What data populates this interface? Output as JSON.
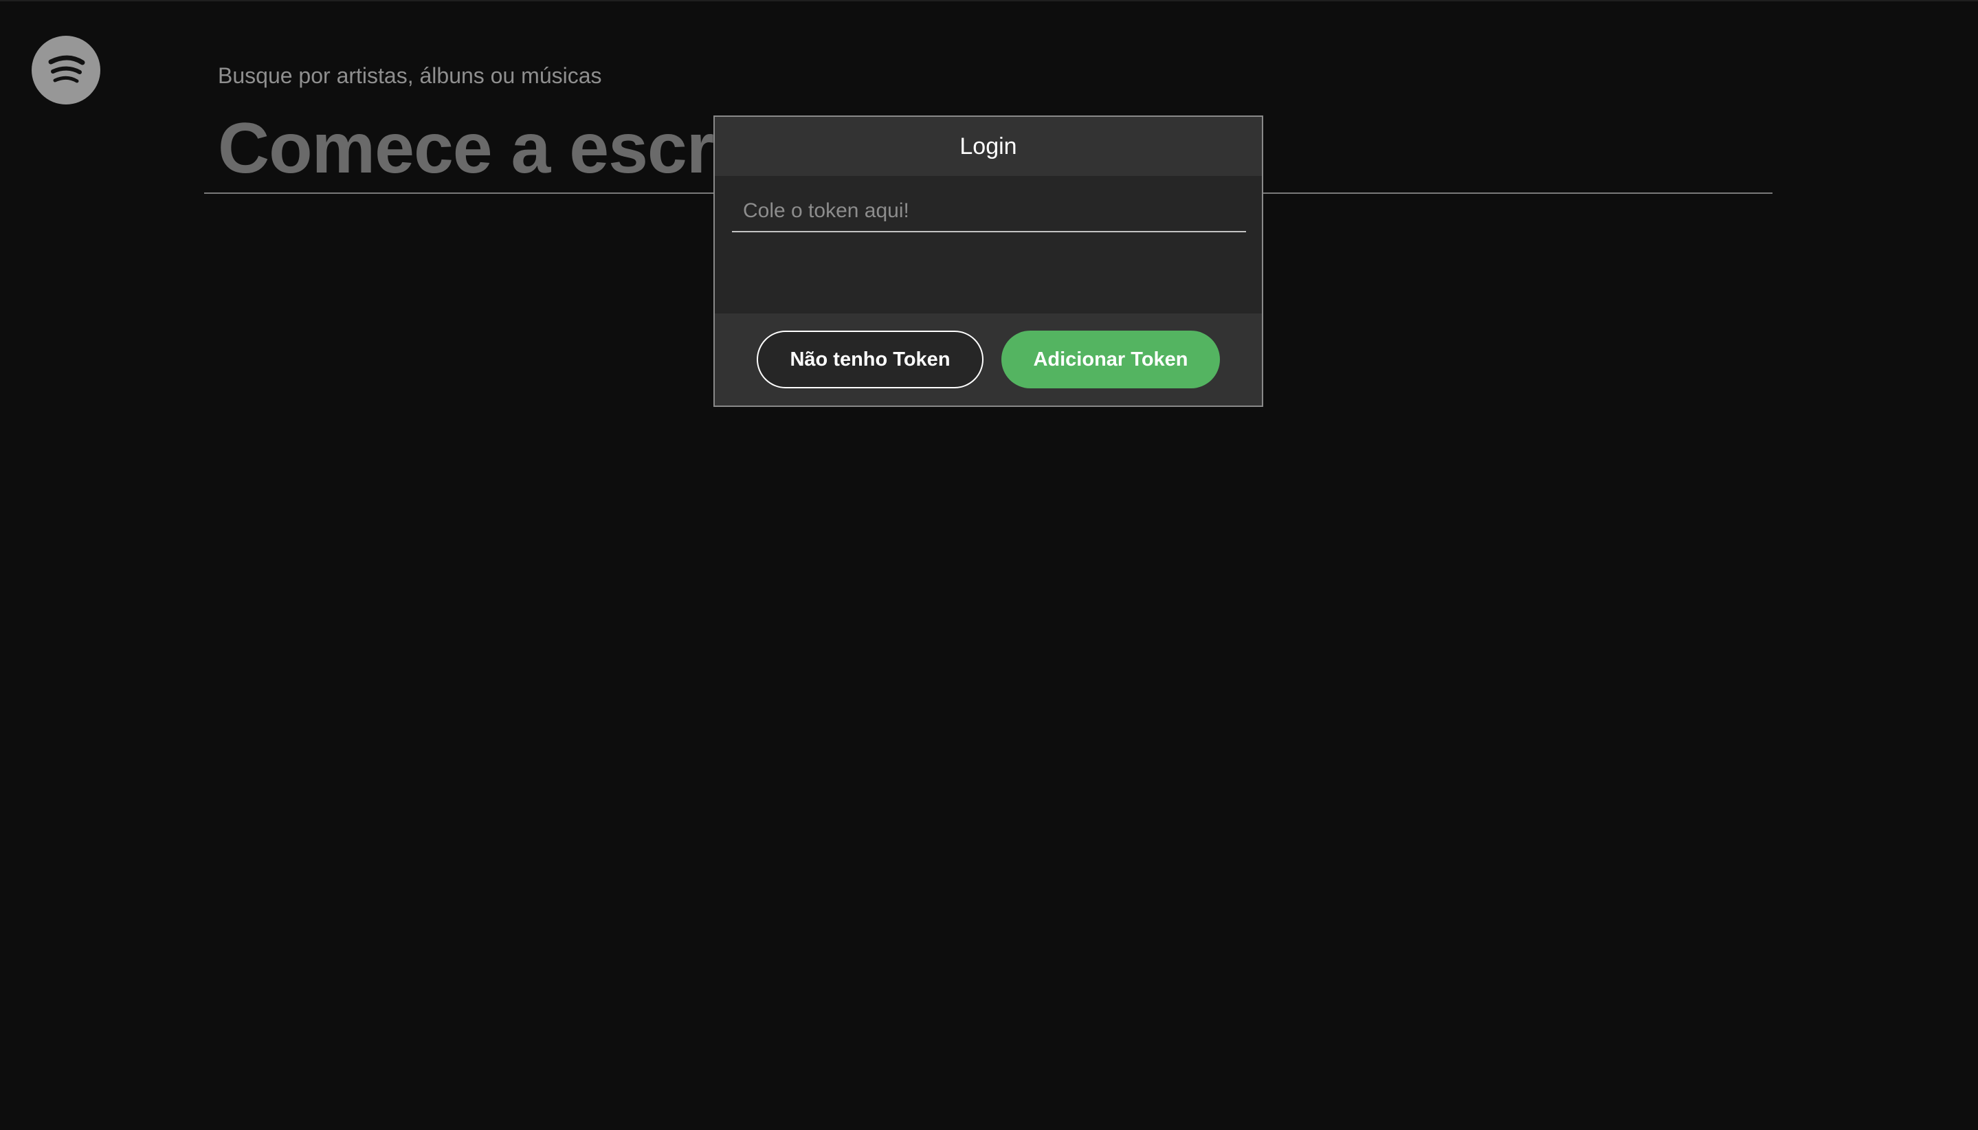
{
  "logo": {
    "icon": "spotify-logo-icon",
    "color": "#979797"
  },
  "search": {
    "hint": "Busque por artistas, álbuns ou músicas",
    "placeholder": "Comece a escrever...",
    "value": ""
  },
  "login_modal": {
    "title": "Login",
    "token_placeholder": "Cole o token aqui!",
    "token_value": "",
    "no_token_label": "Não tenho Token",
    "add_token_label": "Adicionar Token",
    "accent_color": "#54b461"
  }
}
